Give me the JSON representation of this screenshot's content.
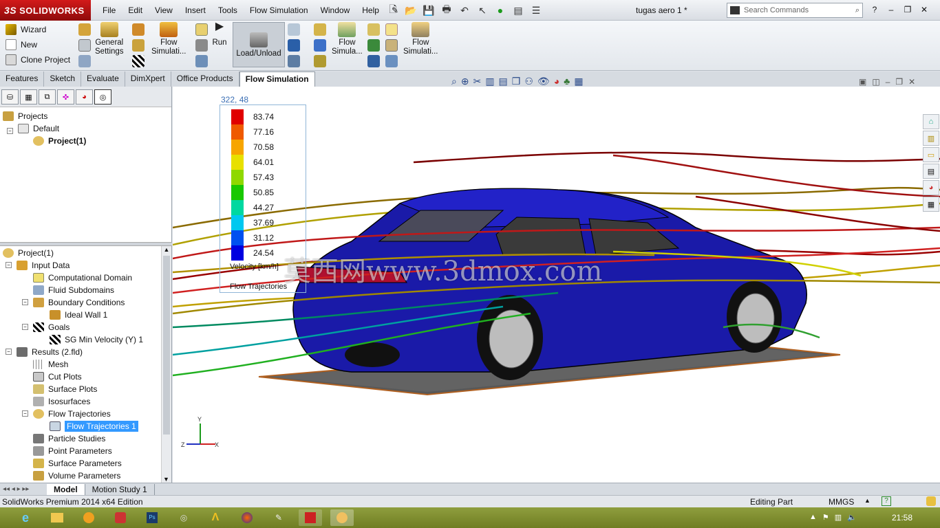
{
  "app": {
    "brand": "SOLIDWORKS",
    "brand_prefix": "3S",
    "document_title": "tugas aero 1 *"
  },
  "menu": [
    "File",
    "Edit",
    "View",
    "Insert",
    "Tools",
    "Flow Simulation",
    "Window",
    "Help"
  ],
  "search": {
    "placeholder": "Search Commands"
  },
  "ribbon": {
    "wizard": "Wizard",
    "new": "New",
    "clone": "Clone Project",
    "general_settings_1": "General",
    "general_settings_2": "Settings",
    "flow_sim_1": "Flow",
    "flow_sim_2": "Simulati...",
    "run": "Run",
    "load_unload": "Load/Unload",
    "flow_sim_b_1": "Flow",
    "flow_sim_b_2": "Simula...",
    "flow_sim_c_1": "Flow",
    "flow_sim_c_2": "Simulati..."
  },
  "tabs": [
    "Features",
    "Sketch",
    "Evaluate",
    "DimXpert",
    "Office Products",
    "Flow Simulation"
  ],
  "active_tab": "Flow Simulation",
  "projects_tree": {
    "root": "Projects",
    "default": "Default",
    "project": "Project(1)"
  },
  "results_tree": {
    "project": "Project(1)",
    "input_data": "Input Data",
    "computational_domain": "Computational Domain",
    "fluid_subdomains": "Fluid Subdomains",
    "boundary_conditions": "Boundary Conditions",
    "ideal_wall": "Ideal Wall 1",
    "goals": "Goals",
    "sg_min_velocity": "SG Min Velocity (Y) 1",
    "results": "Results (2.fld)",
    "mesh": "Mesh",
    "cut_plots": "Cut Plots",
    "surface_plots": "Surface Plots",
    "isosurfaces": "Isosurfaces",
    "flow_trajectories": "Flow Trajectories",
    "flow_trajectories_1": "Flow Trajectories 1",
    "particle_studies": "Particle Studies",
    "point_parameters": "Point Parameters",
    "surface_parameters": "Surface Parameters",
    "volume_parameters": "Volume Parameters"
  },
  "legend": {
    "coord": "322, 48",
    "values": [
      "83.74",
      "77.16",
      "70.58",
      "64.01",
      "57.43",
      "50.85",
      "44.27",
      "37.69",
      "31.12",
      "24.54"
    ],
    "colors": [
      "#e00000",
      "#ef5a00",
      "#f7a500",
      "#e8e000",
      "#8fd800",
      "#18c800",
      "#00d8a0",
      "#00c8f0",
      "#0050f0",
      "#0000e0"
    ],
    "unit": "Velocity [km/h]",
    "title": "Flow Trajectories"
  },
  "watermark": "莫西网www.3dmox.com",
  "triad": {
    "x": "X",
    "y": "Y",
    "z": "Z"
  },
  "bottom_tabs": [
    "Model",
    "Motion Study 1"
  ],
  "status": {
    "edition": "SolidWorks Premium 2014 x64 Edition",
    "mode": "Editing Part",
    "units": "MMGS"
  },
  "taskbar": {
    "time": "21:58"
  }
}
